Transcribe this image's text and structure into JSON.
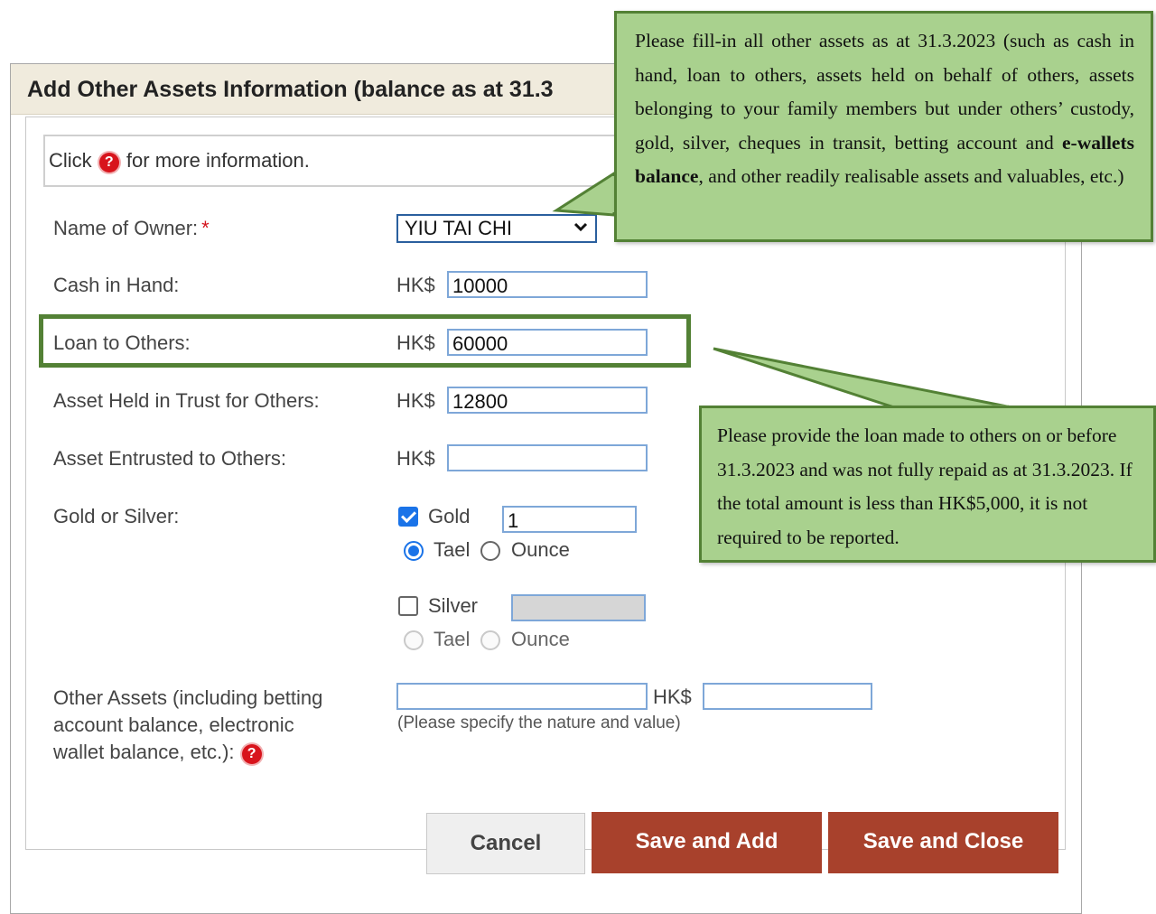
{
  "dialog": {
    "title": "Add Other Assets Information (balance as at 31.3"
  },
  "info": {
    "prefix": "Click",
    "suffix": "for more information."
  },
  "help_icon_glyph": "?",
  "form": {
    "owner": {
      "label": "Name of Owner:",
      "required_mark": "*",
      "selected": "YIU TAI CHI",
      "arrow": "⌄"
    },
    "cash": {
      "label": "Cash in Hand:",
      "currency": "HK$",
      "value": "10000"
    },
    "loan": {
      "label": "Loan to Others:",
      "currency": "HK$",
      "value": "60000"
    },
    "trust": {
      "label": "Asset Held in Trust for Others:",
      "currency": "HK$",
      "value": "12800"
    },
    "entrusted": {
      "label": "Asset Entrusted to Others:",
      "currency": "HK$",
      "value": ""
    },
    "gold_silver": {
      "label": "Gold or Silver:",
      "gold": {
        "label": "Gold",
        "checked": true,
        "value": "1",
        "unit_selected": "Tael"
      },
      "silver": {
        "label": "Silver",
        "checked": false,
        "value": ""
      },
      "tael": "Tael",
      "ounce": "Ounce"
    },
    "other": {
      "label_line1": "Other Assets (including betting",
      "label_line2": "account balance, electronic",
      "label_line3": "wallet balance, etc.):",
      "nature_value": "",
      "currency": "HK$",
      "amount_value": "",
      "note": "(Please specify the nature and value)"
    }
  },
  "buttons": {
    "cancel": "Cancel",
    "save_add": "Save and Add",
    "save_close": "Save and Close"
  },
  "callouts": {
    "top": {
      "line1": "Please fill-in all other assets as at 31.3.2023 (such as cash in hand, loan to others, assets held on behalf of others, assets belonging to your family members but under others’ custody, gold, silver, cheques in transit, betting account and ",
      "bold": "e-wallets balance",
      "line2": ", and other readily realisable assets and valuables, etc.)"
    },
    "loan": {
      "text": "Please provide the loan made to others on or before 31.3.2023 and was not fully repaid as at 31.3.2023. If the total amount is less than HK$5,000, it is not required to be reported."
    }
  },
  "colors": {
    "callout_fill": "#a9d18e",
    "callout_border": "#538135",
    "button_primary": "#a8412c",
    "header_bg": "#f0ebdd",
    "help_icon": "#d8141c"
  }
}
